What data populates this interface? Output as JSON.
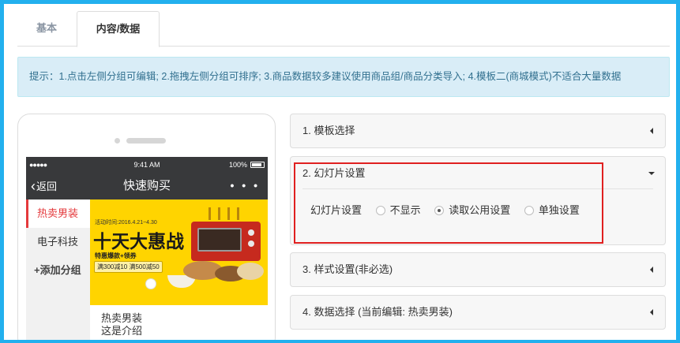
{
  "tabs": [
    {
      "label": "基本"
    },
    {
      "label": "内容/数据"
    }
  ],
  "tip": "提示：1.点击左侧分组可编辑; 2.拖拽左侧分组可排序; 3.商品数据较多建议使用商品组/商品分类导入; 4.模板二(商城模式)不适合大量数据",
  "phone": {
    "status": {
      "signal": "●●●●● ",
      "time": "9:41 AM",
      "battery": "100%"
    },
    "nav": {
      "back": "返回",
      "title": "快速购买",
      "more": "• • •"
    },
    "categories": [
      {
        "label": "热卖男装",
        "active": true
      },
      {
        "label": "电子科技",
        "active": false
      },
      {
        "label": "+添加分组",
        "active": false
      }
    ],
    "banner": {
      "date": "活动时间:2016.4.21~4.30",
      "headline": "十天大惠战",
      "sub": "特惠爆款+领券",
      "coupon": "满300减10 满500减50"
    },
    "product": {
      "name": "热卖男装",
      "desc": "这是介绍"
    }
  },
  "panels": {
    "p1": "1. 模板选择",
    "p2": "2. 幻灯片设置",
    "p3": "3. 样式设置(非必选)",
    "p4": "4. 数据选择 (当前编辑: 热卖男装)"
  },
  "slides": {
    "label": "幻灯片设置",
    "options": [
      {
        "label": "不显示",
        "selected": false
      },
      {
        "label": "读取公用设置",
        "selected": true
      },
      {
        "label": "单独设置",
        "selected": false
      }
    ]
  },
  "colors": {
    "accent_red": "#e4393c",
    "highlight": "#e02020",
    "tip_bg": "#d9edf7",
    "frame_border": "#22b0ee"
  }
}
